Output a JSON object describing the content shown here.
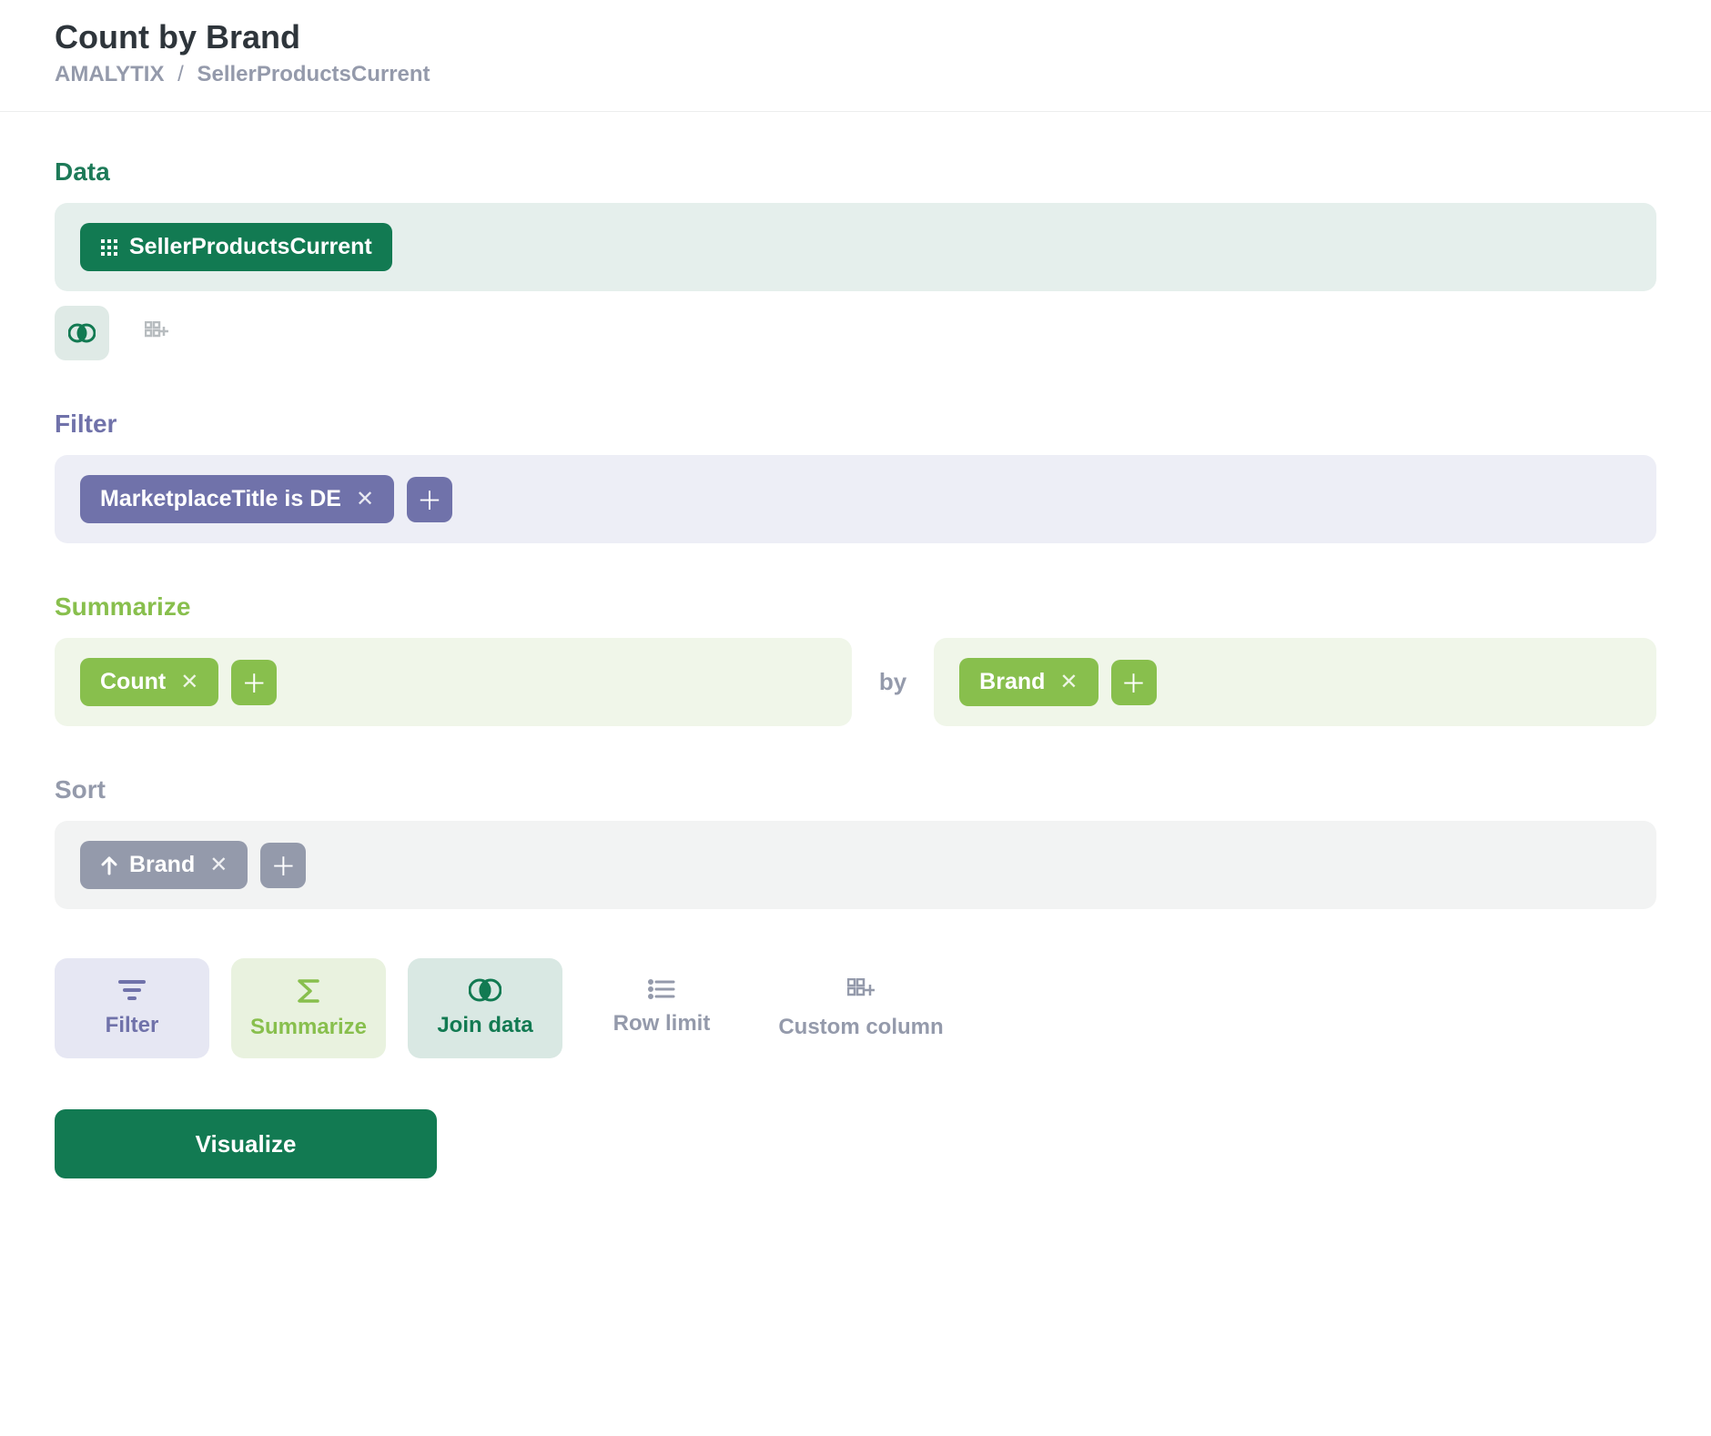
{
  "header": {
    "title": "Count by Brand",
    "breadcrumb": {
      "root": "AMALYTIX",
      "separator": "/",
      "leaf": "SellerProductsCurrent"
    }
  },
  "data_section": {
    "title": "Data",
    "source_pill": "SellerProductsCurrent"
  },
  "filter_section": {
    "title": "Filter",
    "pills": [
      {
        "label": "MarketplaceTitle is DE"
      }
    ]
  },
  "summarize_section": {
    "title": "Summarize",
    "aggregations": [
      {
        "label": "Count"
      }
    ],
    "by_word": "by",
    "groupings": [
      {
        "label": "Brand"
      }
    ]
  },
  "sort_section": {
    "title": "Sort",
    "items": [
      {
        "label": "Brand",
        "direction": "asc"
      }
    ]
  },
  "actions": {
    "filter": "Filter",
    "summarize": "Summarize",
    "join": "Join data",
    "row_limit": "Row limit",
    "custom_column": "Custom column"
  },
  "visualize_button": "Visualize"
}
